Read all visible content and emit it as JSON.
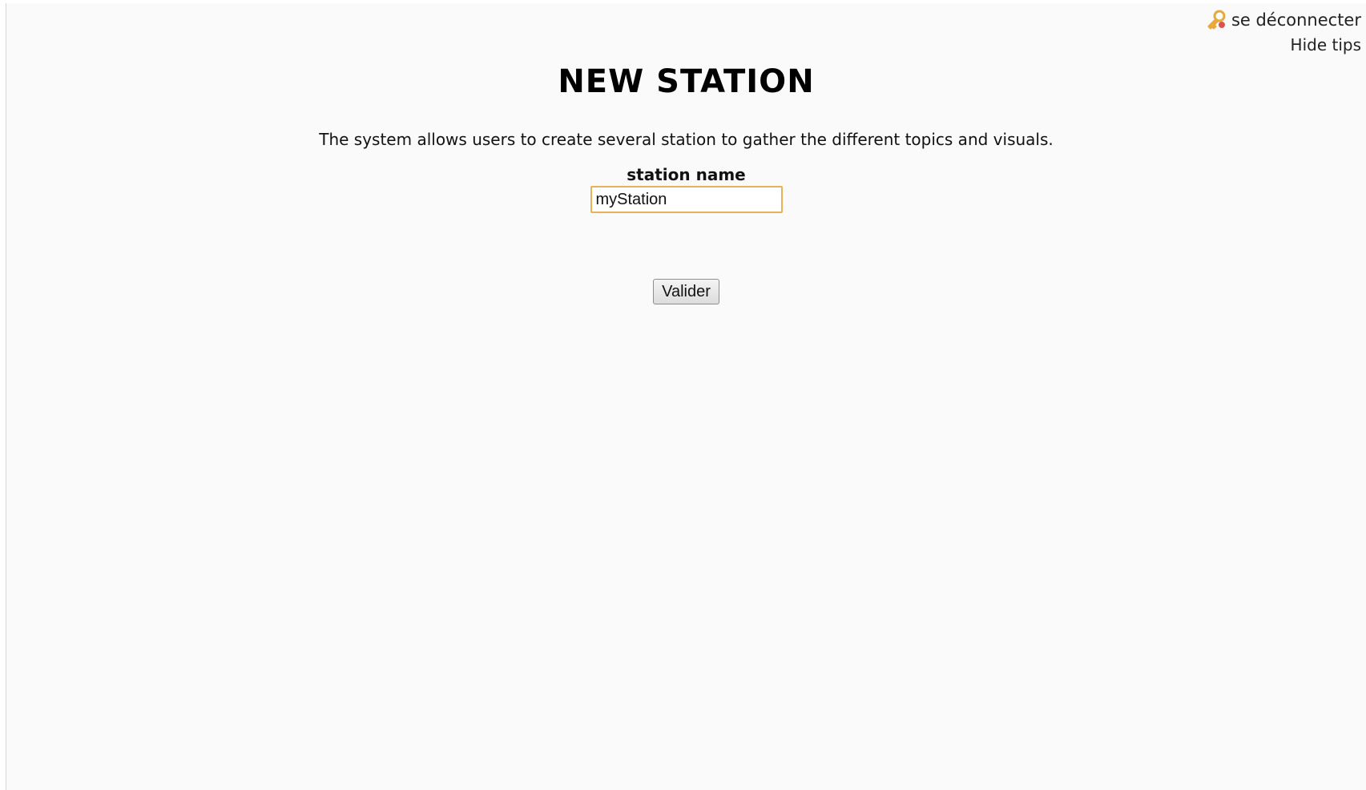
{
  "header": {
    "logout_label": "se déconnecter",
    "logout_icon": "key-icon",
    "hide_tips_label": "Hide tips"
  },
  "main": {
    "title": "NEW STATION",
    "description": "The system allows users to create several station to gather the different topics and visuals.",
    "station_name_label": "station name",
    "station_name_value": "myStation",
    "submit_label": "Valider"
  },
  "colors": {
    "page_background": "#fafafa",
    "input_focus_border": "#e8b256",
    "icon_key": "#e7a93b"
  }
}
